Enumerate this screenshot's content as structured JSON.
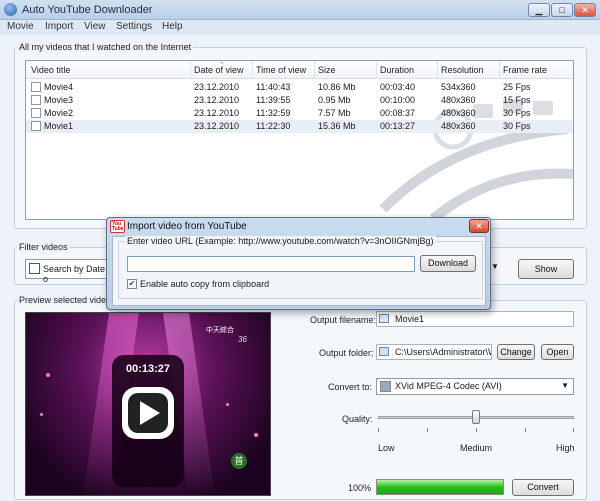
{
  "window": {
    "title": "Auto YouTube Downloader"
  },
  "menu": [
    "Movie",
    "Import",
    "View",
    "Settings",
    "Help"
  ],
  "videos_group": {
    "label": "All my videos that I watched on the Internet",
    "columns": [
      "Video title",
      "Date of view",
      "Time of view",
      "Size",
      "Duration",
      "Resolution",
      "Frame rate"
    ],
    "rows": [
      {
        "title": "Movie4",
        "date": "23.12.2010",
        "time": "11:40:43",
        "size": "10.86 Mb",
        "duration": "00:03:40",
        "resolution": "534x360",
        "fps": "25 Fps"
      },
      {
        "title": "Movie3",
        "date": "23.12.2010",
        "time": "11:39:55",
        "size": "0.95 Mb",
        "duration": "00:10:00",
        "resolution": "480x360",
        "fps": "15 Fps"
      },
      {
        "title": "Movie2",
        "date": "23.12.2010",
        "time": "11:32:59",
        "size": "7.57 Mb",
        "duration": "00:08:37",
        "resolution": "480x360",
        "fps": "30 Fps"
      },
      {
        "title": "Movie1",
        "date": "23.12.2010",
        "time": "11:22:30",
        "size": "15.36 Mb",
        "duration": "00:13:27",
        "resolution": "480x360",
        "fps": "30 Fps"
      }
    ]
  },
  "filter_group": {
    "label": "Filter videos",
    "combo_value": "Search by Date o",
    "show_label": "Show"
  },
  "preview_group": {
    "label": "Preview selected video",
    "timecode": "00:13:27",
    "channel_logo": "中天綜合",
    "channel_num": "36"
  },
  "output": {
    "filename_label": "Output filename:",
    "filename_value": "Movie1",
    "folder_label": "Output folder:",
    "folder_value": "C:\\Users\\Administrator\\Wi",
    "change_label": "Change",
    "open_label": "Open",
    "convert_to_label": "Convert to:",
    "codec_value": "XVid MPEG-4 Codec (AVI)",
    "quality_label": "Quality:",
    "quality_level": 0.5,
    "quality_low": "Low",
    "quality_medium": "Medium",
    "quality_high": "High",
    "progress_text": "100%",
    "progress_value": 1.0,
    "convert_label": "Convert"
  },
  "dialog": {
    "title": "Import video from YouTube",
    "icon_text": "You Tube",
    "prompt": "Enter video URL (Example: http://www.youtube.com/watch?v=3nOIIGNmjBg)",
    "url_value": "",
    "download_label": "Download",
    "auto_copy_label": "Enable auto copy from clipboard",
    "auto_copy_checked": true
  },
  "colors": {
    "progress": "#27c21a",
    "dialog_close": "#d04833"
  }
}
